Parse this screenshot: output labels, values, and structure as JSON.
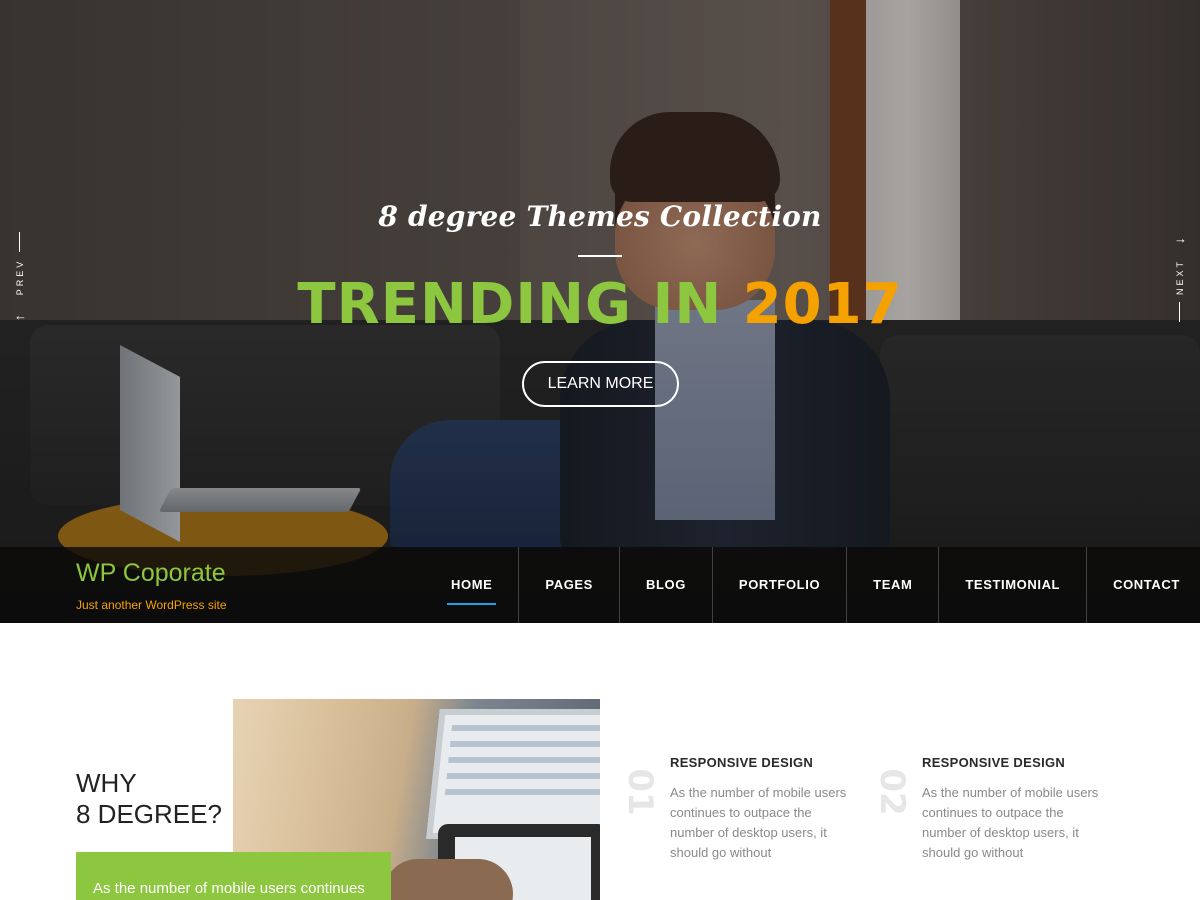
{
  "hero": {
    "subtitle": "8 degree Themes Collection",
    "title_part1": "TRENDING IN",
    "title_part2": "2017",
    "button_label": "LEARN MORE",
    "prev_label": "PREV",
    "next_label": "NEXT",
    "colors": {
      "green": "#8dc63f",
      "orange": "#f5a200"
    }
  },
  "brand": {
    "title": "WP Coporate",
    "tagline": "Just another WordPress site"
  },
  "menu": {
    "items": [
      {
        "label": "HOME",
        "active": true
      },
      {
        "label": "PAGES"
      },
      {
        "label": "BLOG"
      },
      {
        "label": "PORTFOLIO"
      },
      {
        "label": "TEAM"
      },
      {
        "label": "TESTIMONIAL"
      },
      {
        "label": "CONTACT US"
      }
    ],
    "active_underline_color": "#1e9ee6"
  },
  "why": {
    "title_line1": "WHY",
    "title_line2": "8 DEGREE?",
    "box_text": "As the number of mobile users continues"
  },
  "features": [
    {
      "number": "01",
      "title": "RESPONSIVE DESIGN",
      "text": "As the number of mobile users continues to outpace the number of desktop users, it should go without"
    },
    {
      "number": "02",
      "title": "RESPONSIVE DESIGN",
      "text": "As the number of mobile users continues to outpace the number of desktop users, it should go without"
    }
  ]
}
